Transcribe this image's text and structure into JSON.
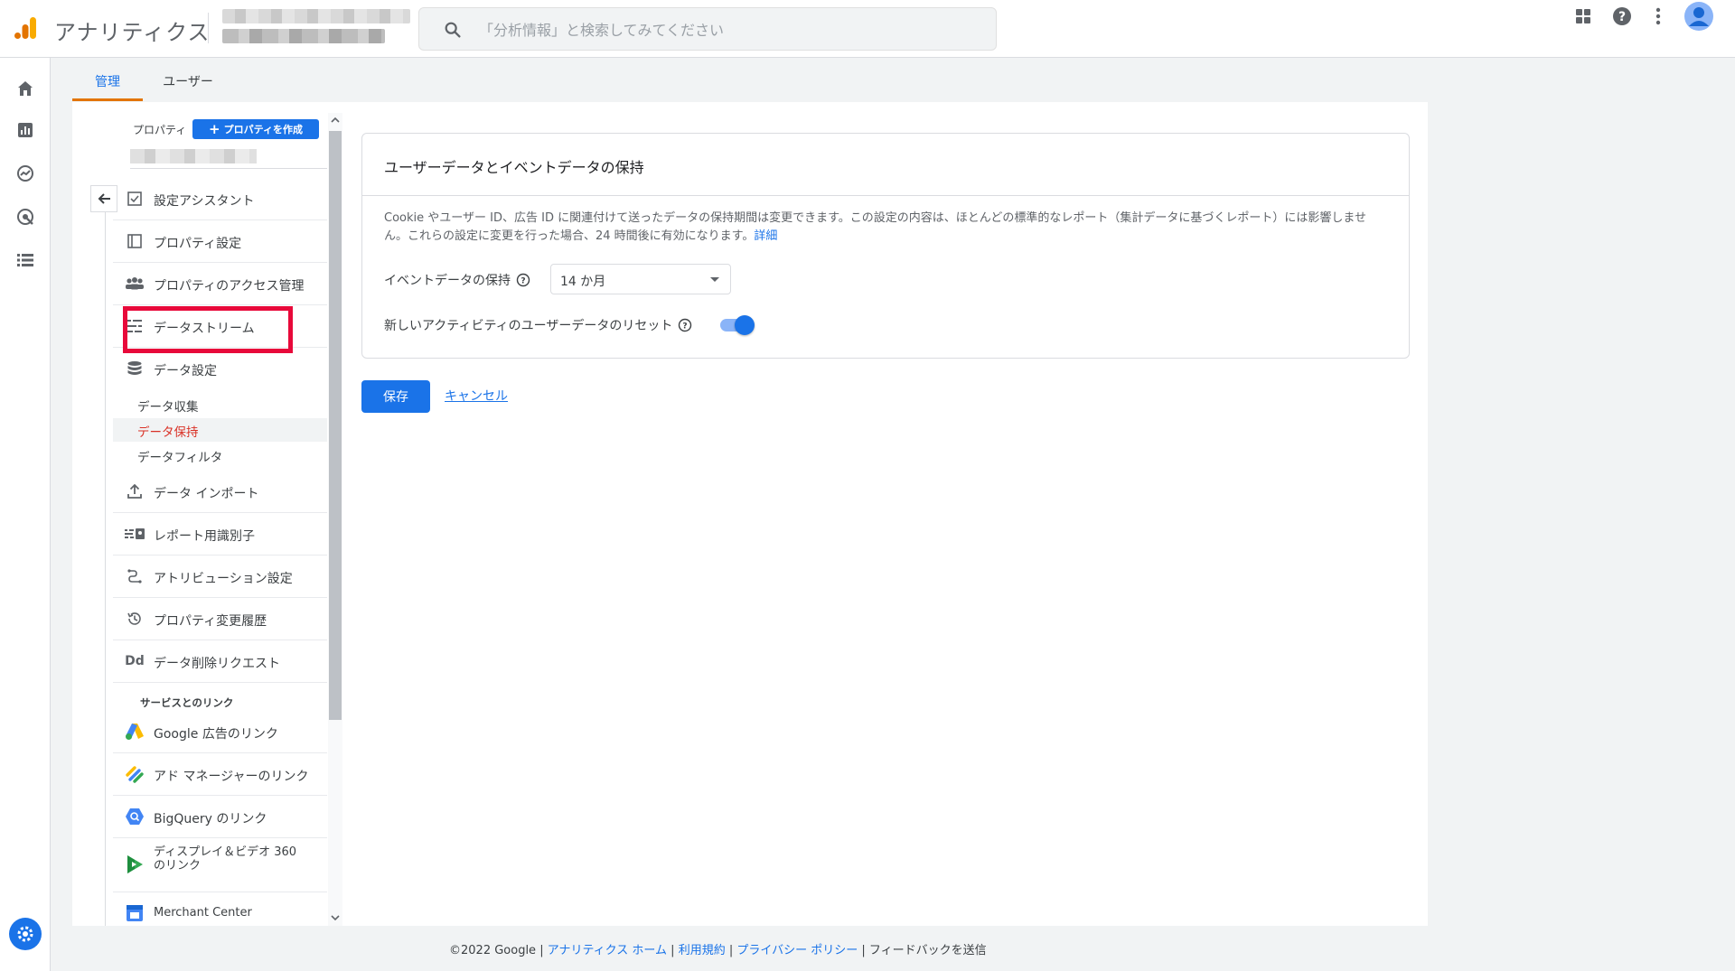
{
  "app": {
    "title": "アナリティクス"
  },
  "search": {
    "placeholder": "「分析情報」と検索してみてください"
  },
  "tabs": [
    {
      "label": "管理"
    },
    {
      "label": "ユーザー"
    }
  ],
  "property": {
    "label": "プロパティ",
    "create_button": "プロパティを作成"
  },
  "nav": {
    "items": [
      {
        "label": "設定アシスタント",
        "icon": "checklist-icon"
      },
      {
        "label": "プロパティ設定",
        "icon": "property-settings-icon"
      },
      {
        "label": "プロパティのアクセス管理",
        "icon": "people-icon"
      },
      {
        "label": "データストリーム",
        "icon": "data-streams-icon"
      },
      {
        "label": "データ設定",
        "icon": "database-icon"
      },
      {
        "label": "データ インポート",
        "icon": "upload-icon"
      },
      {
        "label": "レポート用識別子",
        "icon": "identifier-icon"
      },
      {
        "label": "アトリビューション設定",
        "icon": "attribution-icon"
      },
      {
        "label": "プロパティ変更履歴",
        "icon": "history-icon"
      },
      {
        "label": "データ削除リクエスト",
        "icon": "dd-icon",
        "icon_text": "Dd"
      }
    ],
    "sub_items": [
      {
        "label": "データ収集"
      },
      {
        "label": "データ保持",
        "active": true
      },
      {
        "label": "データフィルタ"
      }
    ],
    "section_heading": "サービスとのリンク",
    "links": [
      {
        "label": "Google 広告のリンク",
        "icon": "google-ads-icon"
      },
      {
        "label": "アド マネージャーのリンク",
        "icon": "ad-manager-icon"
      },
      {
        "label": "BigQuery のリンク",
        "icon": "bigquery-icon"
      },
      {
        "label_line1": "ディスプレイ＆ビデオ 360",
        "label_line2": "のリンク",
        "icon": "dv360-icon"
      },
      {
        "label": "Merchant Center",
        "icon": "merchant-center-icon"
      }
    ]
  },
  "card": {
    "title": "ユーザーデータとイベントデータの保持",
    "description": "Cookie やユーザー ID、広告 ID に関連付けて送ったデータの保持期間は変更できます。この設定の内容は、ほとんどの標準的なレポート（集計データに基づくレポート）には影響しません。これらの設定に変更を行った場合、24 時間後に有効になります。",
    "details_link": "詳細",
    "event_retention_label": "イベントデータの保持",
    "event_retention_value": "14 か月",
    "reset_label": "新しいアクティビティのユーザーデータのリセット",
    "reset_enabled": true
  },
  "actions": {
    "save": "保存",
    "cancel": "キャンセル"
  },
  "footer": {
    "copyright": "©2022 Google",
    "links": [
      "アナリティクス ホーム",
      "利用規約",
      "プライバシー ポリシー"
    ],
    "feedback": "フィードバックを送信"
  },
  "colors": {
    "accent": "#1a73e8",
    "highlight_box": "#e8093a",
    "active_sub_item": "#d93025",
    "tab_underline": "#e37400"
  }
}
